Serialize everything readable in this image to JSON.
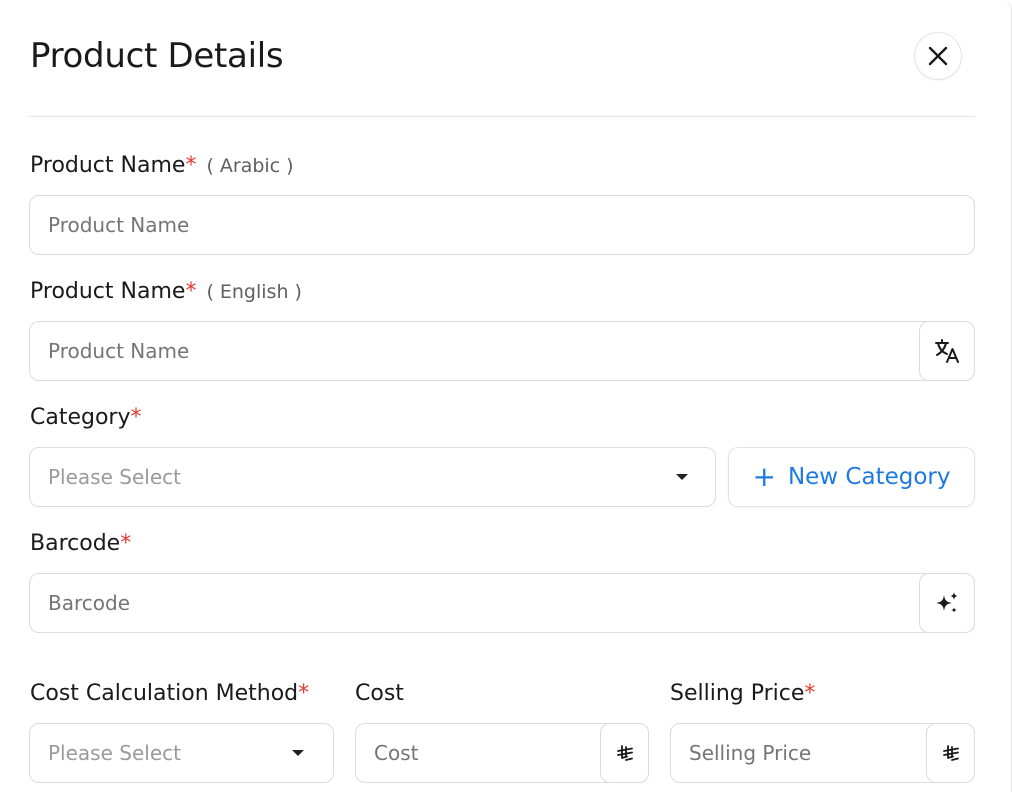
{
  "header": {
    "title": "Product Details"
  },
  "fields": {
    "name_ar": {
      "label": "Product Name",
      "required": "*",
      "sub": "( Arabic )",
      "placeholder": "Product Name"
    },
    "name_en": {
      "label": "Product Name",
      "required": "*",
      "sub": "( English )",
      "placeholder": "Product Name",
      "suffix_icon": "translate-icon"
    },
    "category": {
      "label": "Category",
      "required": "*",
      "placeholder": "Please Select",
      "new_button": "New Category"
    },
    "barcode": {
      "label": "Barcode",
      "required": "*",
      "placeholder": "Barcode",
      "suffix_icon": "sparkles-icon"
    },
    "cost_method": {
      "label": "Cost Calculation Method",
      "required": "*",
      "placeholder": "Please Select"
    },
    "cost": {
      "label": "Cost",
      "placeholder": "Cost",
      "currency_symbol": "⃁"
    },
    "selling_price": {
      "label": "Selling Price",
      "required": "*",
      "placeholder": "Selling Price",
      "currency_symbol": "⃁"
    }
  },
  "colors": {
    "required": "#e53935",
    "accent": "#1e7ae0"
  }
}
